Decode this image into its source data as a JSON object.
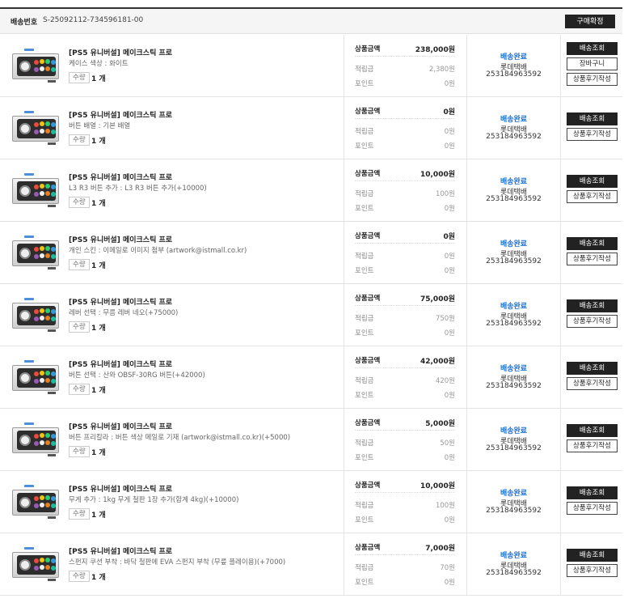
{
  "header": {
    "label": "배송번호",
    "order_number": "S-25092112-734596181-00",
    "confirm_label": "구매확정"
  },
  "labels": {
    "price": "상품금액",
    "reserve": "적립금",
    "point": "포인트",
    "quantity": "수량"
  },
  "colors": {
    "header_bg": "#f5f5f5",
    "dark_button": "#222222",
    "shipping_status": "#1a6fd4"
  },
  "items": [
    {
      "title": "[PS5 유니버설] 메이크스틱 프로",
      "option": "케이스 색상 : 화이트",
      "quantity": "1 개",
      "price": "238,000원",
      "reserve": "2,380원",
      "point": "0원",
      "ship_status": "배송완료",
      "ship_company": "롯데택배",
      "tracking": "253184963592",
      "actions": [
        {
          "label": "배송조회",
          "style": "dark"
        },
        {
          "label": "장바구니",
          "style": "light"
        },
        {
          "label": "상품후기작성",
          "style": "light"
        }
      ]
    },
    {
      "title": "[PS5 유니버설] 메이크스틱 프로",
      "option": "버튼 배열 : 기본 배열",
      "quantity": "1 개",
      "price": "0원",
      "reserve": "0원",
      "point": "0원",
      "ship_status": "배송완료",
      "ship_company": "롯데택배",
      "tracking": "253184963592",
      "actions": [
        {
          "label": "배송조회",
          "style": "dark"
        },
        {
          "label": "상품후기작성",
          "style": "light"
        }
      ]
    },
    {
      "title": "[PS5 유니버설] 메이크스틱 프로",
      "option": "L3 R3 버튼 추가 : L3 R3 버튼 추가(+10000)",
      "quantity": "1 개",
      "price": "10,000원",
      "reserve": "100원",
      "point": "0원",
      "ship_status": "배송완료",
      "ship_company": "롯데택배",
      "tracking": "253184963592",
      "actions": [
        {
          "label": "배송조회",
          "style": "dark"
        },
        {
          "label": "상품후기작성",
          "style": "light"
        }
      ]
    },
    {
      "title": "[PS5 유니버설] 메이크스틱 프로",
      "option": "개인 스킨 : 이메일로 이미지 첨부 (artwork@istmall.co.kr)",
      "quantity": "1 개",
      "price": "0원",
      "reserve": "0원",
      "point": "0원",
      "ship_status": "배송완료",
      "ship_company": "롯데택배",
      "tracking": "253184963592",
      "actions": [
        {
          "label": "배송조회",
          "style": "dark"
        },
        {
          "label": "상품후기작성",
          "style": "light"
        }
      ]
    },
    {
      "title": "[PS5 유니버설] 메이크스틱 프로",
      "option": "레버 선택 : 무름 레버 네오(+75000)",
      "quantity": "1 개",
      "price": "75,000원",
      "reserve": "750원",
      "point": "0원",
      "ship_status": "배송완료",
      "ship_company": "롯데택배",
      "tracking": "253184963592",
      "actions": [
        {
          "label": "배송조회",
          "style": "dark"
        },
        {
          "label": "상품후기작성",
          "style": "light"
        }
      ]
    },
    {
      "title": "[PS5 유니버설] 메이크스틱 프로",
      "option": "버튼 선택 : 산와 OBSF-30RG 버튼(+42000)",
      "quantity": "1 개",
      "price": "42,000원",
      "reserve": "420원",
      "point": "0원",
      "ship_status": "배송완료",
      "ship_company": "롯데택배",
      "tracking": "253184963592",
      "actions": [
        {
          "label": "배송조회",
          "style": "dark"
        },
        {
          "label": "상품후기작성",
          "style": "light"
        }
      ]
    },
    {
      "title": "[PS5 유니버설] 메이크스틱 프로",
      "option": "버튼 프리칼라 : 버튼 색상 메일로 기재 (artwork@istmall.co.kr)(+5000)",
      "quantity": "1 개",
      "price": "5,000원",
      "reserve": "50원",
      "point": "0원",
      "ship_status": "배송완료",
      "ship_company": "롯데택배",
      "tracking": "253184963592",
      "actions": [
        {
          "label": "배송조회",
          "style": "dark"
        },
        {
          "label": "상품후기작성",
          "style": "light"
        }
      ]
    },
    {
      "title": "[PS5 유니버설] 메이크스틱 프로",
      "option": "무게 추가 : 1kg 무게 철판 1장 추가(합계 4kg)(+10000)",
      "quantity": "1 개",
      "price": "10,000원",
      "reserve": "100원",
      "point": "0원",
      "ship_status": "배송완료",
      "ship_company": "롯데택배",
      "tracking": "253184963592",
      "actions": [
        {
          "label": "배송조회",
          "style": "dark"
        },
        {
          "label": "상품후기작성",
          "style": "light"
        }
      ]
    },
    {
      "title": "[PS5 유니버설] 메이크스틱 프로",
      "option": "스펀지 쿠션 부착 : 바닥 철판에 EVA 스펀지 부착 (무릎 플레이용)(+7000)",
      "quantity": "1 개",
      "price": "7,000원",
      "reserve": "70원",
      "point": "0원",
      "ship_status": "배송완료",
      "ship_company": "롯데택배",
      "tracking": "253184963592",
      "actions": [
        {
          "label": "배송조회",
          "style": "dark"
        },
        {
          "label": "상품후기작성",
          "style": "light"
        }
      ]
    }
  ]
}
